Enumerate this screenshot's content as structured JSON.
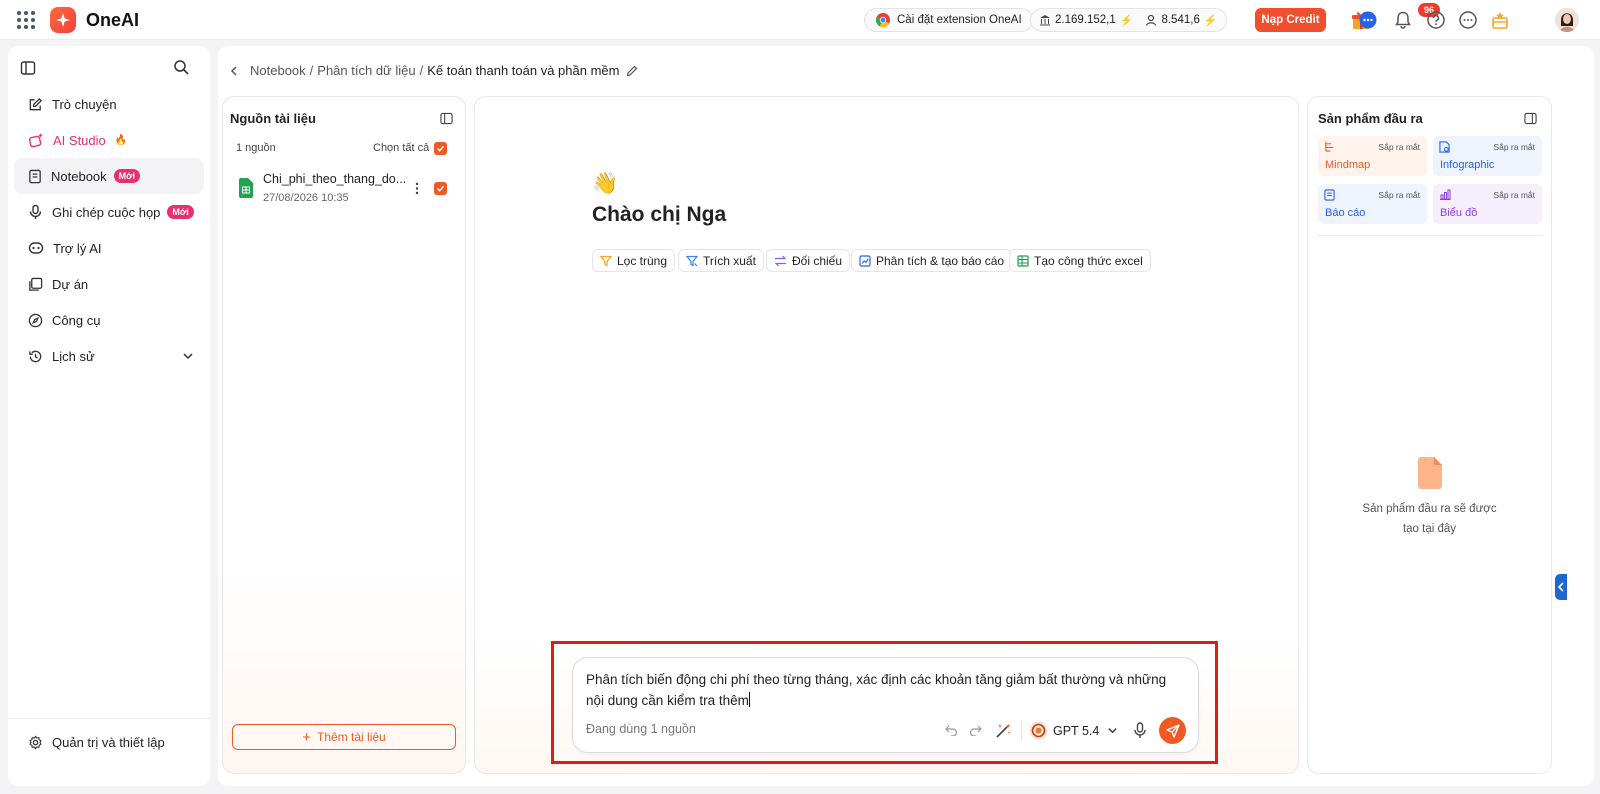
{
  "app": {
    "name": "OneAI"
  },
  "topbar": {
    "extension_label": "Cài đặt extension OneAI",
    "credit_1": "2.169.152,1",
    "credit_2": "8.541,6",
    "topup_label": "Nạp Credit",
    "notification_count": "96"
  },
  "sidebar": {
    "items": [
      {
        "label": "Trò chuyện"
      },
      {
        "label": "AI Studio"
      },
      {
        "label": "Notebook",
        "badge": "Mới"
      },
      {
        "label": "Ghi chép cuộc họp",
        "badge": "Mới"
      },
      {
        "label": "Trợ lý AI"
      },
      {
        "label": "Dự án"
      },
      {
        "label": "Công cụ"
      },
      {
        "label": "Lịch sử"
      }
    ],
    "settings_label": "Quản trị và thiết lập"
  },
  "breadcrumb": {
    "part1": "Notebook",
    "sep": "/",
    "part2": "Phân tích dữ liệu",
    "current": "Kế toán thanh toán và phần mềm"
  },
  "sources": {
    "title": "Nguồn tài liệu",
    "count_label": "1 nguồn",
    "select_all_label": "Chọn tất cả",
    "files": [
      {
        "name": "Chi_phi_theo_thang_do...",
        "date": "27/08/2026 10:35"
      }
    ],
    "add_label": "Thêm tài liệu"
  },
  "chat": {
    "emoji": "👋",
    "greeting": "Chào chị Nga",
    "chips": [
      {
        "label": "Lọc trùng",
        "icon": "filter-icon"
      },
      {
        "label": "Trích xuất",
        "icon": "extract-icon"
      },
      {
        "label": "Đối chiếu",
        "icon": "compare-icon"
      },
      {
        "label": "Phân tích & tạo báo cáo",
        "icon": "chart-icon"
      },
      {
        "label": "Tạo công thức excel",
        "icon": "table-icon"
      }
    ],
    "input_text": "Phân tích biến động chi phí theo từng tháng, xác định các khoản tăng giảm bất thường và những nội dung cần kiểm tra thêm",
    "using_label": "Đang dùng 1 nguồn",
    "model": "GPT 5.4"
  },
  "output": {
    "title": "Sản phẩm đầu ra",
    "cards": [
      {
        "label": "Mindmap",
        "soon": "Sắp ra mắt",
        "color": "#f05a22",
        "bg": "#fff3ec"
      },
      {
        "label": "Infographic",
        "soon": "Sắp ra mắt",
        "color": "#2563eb",
        "bg": "#eef3fe"
      },
      {
        "label": "Báo cáo",
        "soon": "Sắp ra mắt",
        "color": "#2563eb",
        "bg": "#eef3fe"
      },
      {
        "label": "Biểu đồ",
        "soon": "Sắp ra mắt",
        "color": "#8b3fd9",
        "bg": "#f4eefd"
      }
    ],
    "empty_line1": "Sản phẩm đầu ra sẽ được",
    "empty_line2": "tạo tại đây"
  }
}
